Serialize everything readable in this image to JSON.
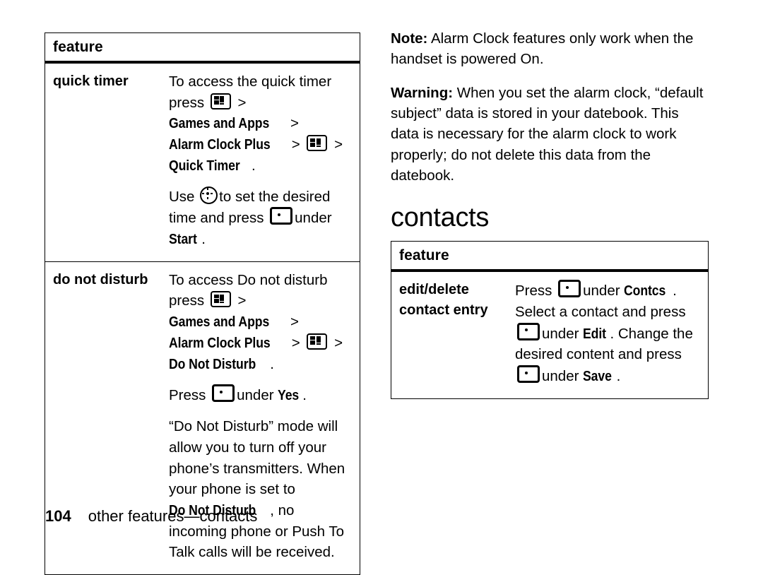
{
  "document": {
    "footer": {
      "page_number": "104",
      "running_head": "other features—contacts"
    }
  },
  "icons": {
    "menu_key": "menu-key-icon",
    "soft_key": "soft-key-icon",
    "nav_key": "navigation-key-icon"
  },
  "left_table": {
    "header": "feature",
    "rows": [
      {
        "term": "quick timer",
        "paragraphs": [
          {
            "parts": [
              {
                "t": "text",
                "v": "To access the quick timer press "
              },
              {
                "t": "icon",
                "v": "menu_key"
              },
              {
                "t": "gt",
                "v": ">"
              },
              {
                "t": "bold",
                "v": "Games and Apps"
              },
              {
                "t": "gt",
                "v": ">"
              },
              {
                "t": "bold",
                "v": "Alarm Clock Plus"
              },
              {
                "t": "gt",
                "v": ">"
              },
              {
                "t": "icon",
                "v": "menu_key"
              },
              {
                "t": "gt",
                "v": ">"
              },
              {
                "t": "bold",
                "v": "Quick Timer"
              },
              {
                "t": "text",
                "v": "."
              }
            ]
          },
          {
            "parts": [
              {
                "t": "text",
                "v": "Use "
              },
              {
                "t": "icon",
                "v": "nav_key"
              },
              {
                "t": "text",
                "v": "to set the desired time and press "
              },
              {
                "t": "icon",
                "v": "soft_key"
              },
              {
                "t": "text",
                "v": "under "
              },
              {
                "t": "bold",
                "v": "Start"
              },
              {
                "t": "text",
                "v": "."
              }
            ]
          }
        ]
      },
      {
        "term": "do not disturb",
        "paragraphs": [
          {
            "parts": [
              {
                "t": "text",
                "v": "To access Do not disturb press "
              },
              {
                "t": "icon",
                "v": "menu_key"
              },
              {
                "t": "gt",
                "v": ">"
              },
              {
                "t": "bold",
                "v": "Games and Apps"
              },
              {
                "t": "gt",
                "v": ">"
              },
              {
                "t": "bold",
                "v": "Alarm Clock Plus"
              },
              {
                "t": "gt",
                "v": ">"
              },
              {
                "t": "icon",
                "v": "menu_key"
              },
              {
                "t": "gt",
                "v": ">"
              },
              {
                "t": "bold",
                "v": "Do Not Disturb"
              },
              {
                "t": "text",
                "v": "."
              }
            ]
          },
          {
            "parts": [
              {
                "t": "text",
                "v": "Press "
              },
              {
                "t": "icon",
                "v": "soft_key"
              },
              {
                "t": "text",
                "v": "under "
              },
              {
                "t": "bold",
                "v": "Yes"
              },
              {
                "t": "text",
                "v": "."
              }
            ]
          },
          {
            "parts": [
              {
                "t": "text",
                "v": "“Do Not Disturb” mode will allow you to turn off your phone’s transmitters. When your phone is set to "
              },
              {
                "t": "bold",
                "v": "Do Not Disturb"
              },
              {
                "t": "text",
                "v": ", no incoming phone or Push To Talk calls will be received."
              }
            ]
          }
        ]
      }
    ]
  },
  "right_column": {
    "notes": [
      {
        "label": "Note:",
        "text": " Alarm Clock features only work when the handset is powered On."
      },
      {
        "label": "Warning:",
        "text": " When you set the alarm clock, “default subject” data is stored in your datebook. This data is necessary for the alarm clock to work properly; do not delete this data from the datebook."
      }
    ],
    "section_title": "contacts",
    "table": {
      "header": "feature",
      "rows": [
        {
          "term": "edit/delete contact entry",
          "paragraphs": [
            {
              "parts": [
                {
                  "t": "text",
                  "v": "Press "
                },
                {
                  "t": "icon",
                  "v": "soft_key"
                },
                {
                  "t": "text",
                  "v": "under "
                },
                {
                  "t": "bold",
                  "v": "Contcs"
                },
                {
                  "t": "text",
                  "v": ". Select a contact and press "
                },
                {
                  "t": "icon",
                  "v": "soft_key"
                },
                {
                  "t": "text",
                  "v": "under "
                },
                {
                  "t": "bold",
                  "v": "Edit"
                },
                {
                  "t": "text",
                  "v": ". Change the desired content and press "
                },
                {
                  "t": "icon",
                  "v": "soft_key"
                },
                {
                  "t": "text",
                  "v": "under "
                },
                {
                  "t": "bold",
                  "v": "Save"
                },
                {
                  "t": "text",
                  "v": "."
                }
              ]
            }
          ]
        }
      ]
    }
  }
}
